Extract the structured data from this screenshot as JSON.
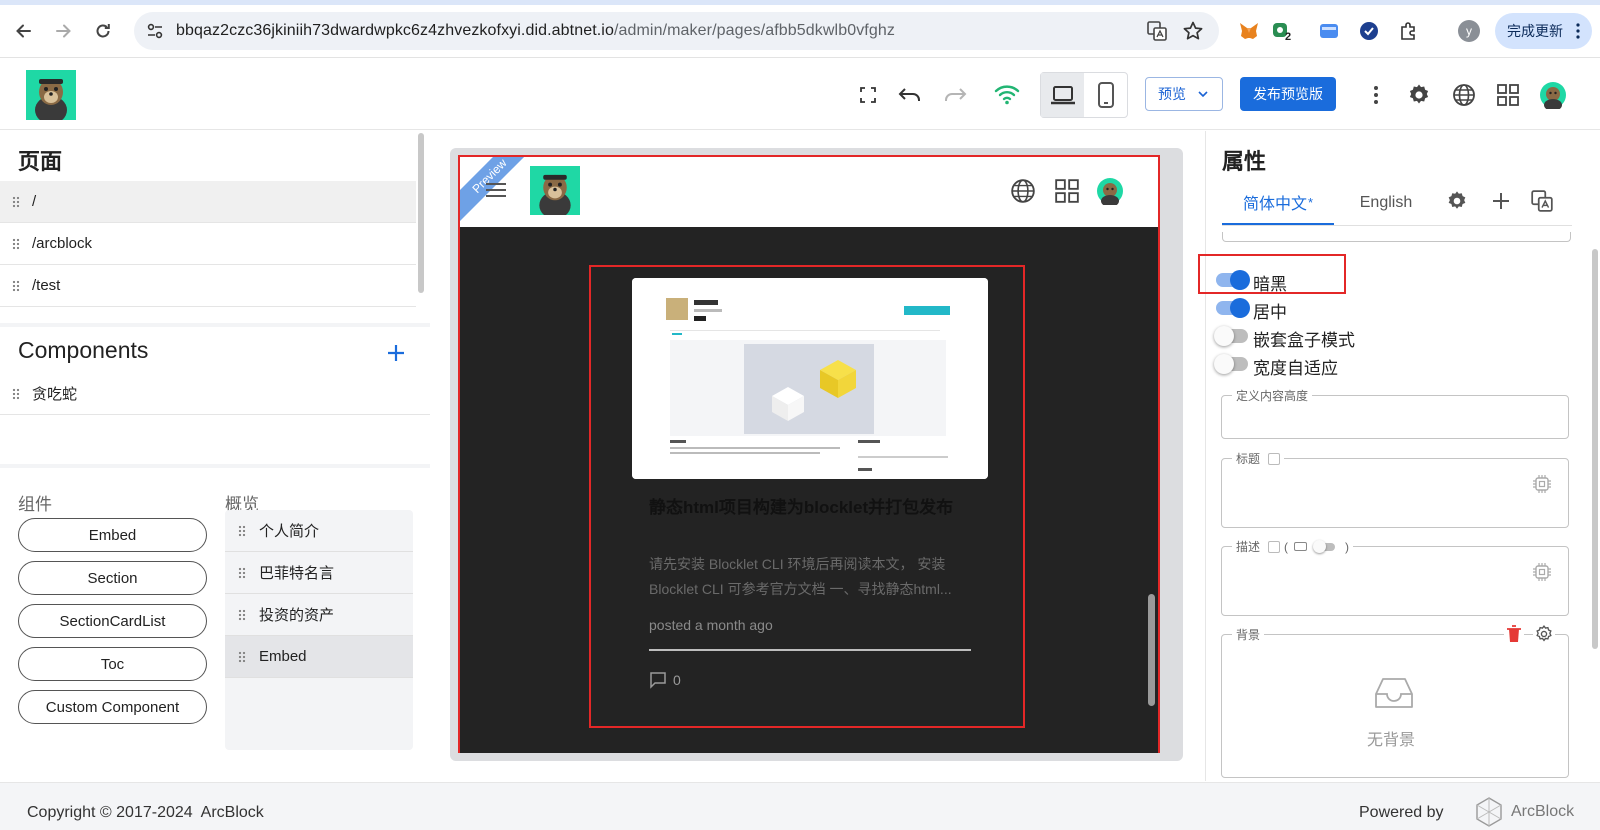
{
  "browser": {
    "url_host": "bbqaz2czc36jkiniih73dwardwpkc6z4zhvezkofxyi.did.abtnet.io",
    "url_path": "/admin/maker/pages/afbb5dkwlb0vfghz",
    "profile_letter": "y",
    "extension_badge": "2",
    "update_label": "完成更新"
  },
  "header": {
    "preview_label": "预览",
    "publish_label": "发布预览版",
    "active_device": "desktop"
  },
  "pages_panel": {
    "title": "页面",
    "pages": [
      "/",
      "/arcblock",
      "/test"
    ],
    "selected_index": 0
  },
  "components_panel": {
    "title": "Components",
    "items": [
      "贪吃蛇"
    ]
  },
  "library": {
    "components_label": "组件",
    "overview_label": "概览",
    "components": [
      "Embed",
      "Section",
      "SectionCardList",
      "Toc",
      "Custom Component"
    ],
    "overview": [
      "个人简介",
      "巴菲特名言",
      "投资的资产",
      "Embed"
    ],
    "overview_selected_index": 3
  },
  "canvas": {
    "ribbon": "Preview",
    "card": {
      "title": "静态html项目构建为blocklet并打包发布",
      "excerpt": "请先安装 Blocklet CLI 环境后再阅读本文， 安装 Blocklet CLI 可参考官方文档 一、寻找静态html...",
      "meta": "posted a month ago",
      "comments": "0"
    }
  },
  "properties": {
    "title": "属性",
    "tabs": [
      "简体中文",
      "English"
    ],
    "active_tab": 0,
    "active_tab_marker": "*",
    "toggles": [
      {
        "label": "暗黑",
        "on": true
      },
      {
        "label": "居中",
        "on": true
      },
      {
        "label": "嵌套盒子模式",
        "on": false
      },
      {
        "label": "宽度自适应",
        "on": false
      }
    ],
    "content_height_label": "定义内容高度",
    "title_field_label": "标题",
    "desc_field_label": "描述",
    "desc_paren_open": "(",
    "desc_paren_close": ")",
    "background_label": "背景",
    "no_background": "无背景"
  },
  "footer": {
    "copyright": "Copyright © 2017-2024  ArcBlock",
    "powered_by": "Powered by",
    "brand": "ArcBlock"
  },
  "colors": {
    "accent": "#1a6cdc",
    "highlight_box": "#e32727",
    "dark_bg": "#232323"
  }
}
